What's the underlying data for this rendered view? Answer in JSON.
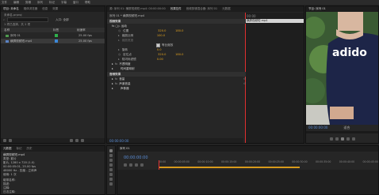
{
  "menu": [
    "文件",
    "编辑",
    "剪辑",
    "序列",
    "标记",
    "字幕",
    "窗口",
    "帮助"
  ],
  "project": {
    "tabs": [
      "项目: 未命名",
      "媒体浏览器",
      "信息",
      "效果"
    ],
    "path": "未命名.prproj",
    "search_placeholder": "",
    "inpoint_label": "入口: 全部",
    "count": "1 项已选择，共 2 项",
    "headers": [
      "名称",
      "标签",
      "帧速率"
    ],
    "items": [
      {
        "name": "序列 01",
        "label_color": "#2fb04b",
        "fps": "25.00 fps"
      },
      {
        "name": "横屏视频短.mp4",
        "label_color": "#3c88d8",
        "fps": "25.00 fps"
      }
    ]
  },
  "effect_controls": {
    "tabs": [
      "源: 序列 01: 横屏视频短.mp4: 00:00:00:00",
      "效果控件",
      "音频剪辑混合器: 序列 01",
      "元数据"
    ],
    "clip_title": "序列 01 * 横屏视频短.mp4",
    "timeline_clip": "横屏视频短.mp4",
    "ruler_start": "00:00",
    "video_section": "视频效果",
    "motion": "fx ▢▷ 运动",
    "position_label": "位置",
    "position_x": "320.0",
    "position_y": "180.0",
    "scale_label": "缩放比例",
    "scale_val": "100.0",
    "scale_w_label": "缩放宽度",
    "uniform_label": "等比缩放",
    "rotation_label": "旋转",
    "rotation_val": "0.0",
    "anchor_label": "定位点",
    "anchor_x": "320.0",
    "anchor_y": "180.0",
    "flicker_label": "防闪烁滤镜",
    "flicker_val": "0.00",
    "opacity": "不透明度",
    "time_remap": "时间重映射",
    "audio_section": "音频效果",
    "volume": "音量",
    "channel_volume": "声道音量",
    "panner": "声像器",
    "timecode": "00:00:00:00"
  },
  "program": {
    "title": "节目: 序列 01",
    "timecode": "00:00:00:00",
    "fit": "适合",
    "shirt_text": "adido"
  },
  "media": {
    "tabs": [
      "元数据",
      "标记",
      "历史"
    ],
    "file_name": "横屏视频短.mp4",
    "type_label": "类型: 影片",
    "lines": [
      "影片, 1280 x 720 (1.0)",
      "00:00:05:01, 25.00 fps",
      "48000 Hz - 压缩 - 立体声",
      "使用: 1 次"
    ],
    "extra": [
      "磁带名称:",
      "描述:",
      "注释:",
      "日志注释:"
    ]
  },
  "timeline": {
    "tab": "序列 01",
    "timecode": "00:00:00:00",
    "ruler": [
      "00:00",
      "00:00:05:00",
      "00:00:10:00",
      "00:00:15:00",
      "00:00:20:00",
      "00:00:25:00",
      "00:00:30:00",
      "00:00:35:00",
      "00:00:40:00",
      "00:00:45:00"
    ]
  }
}
